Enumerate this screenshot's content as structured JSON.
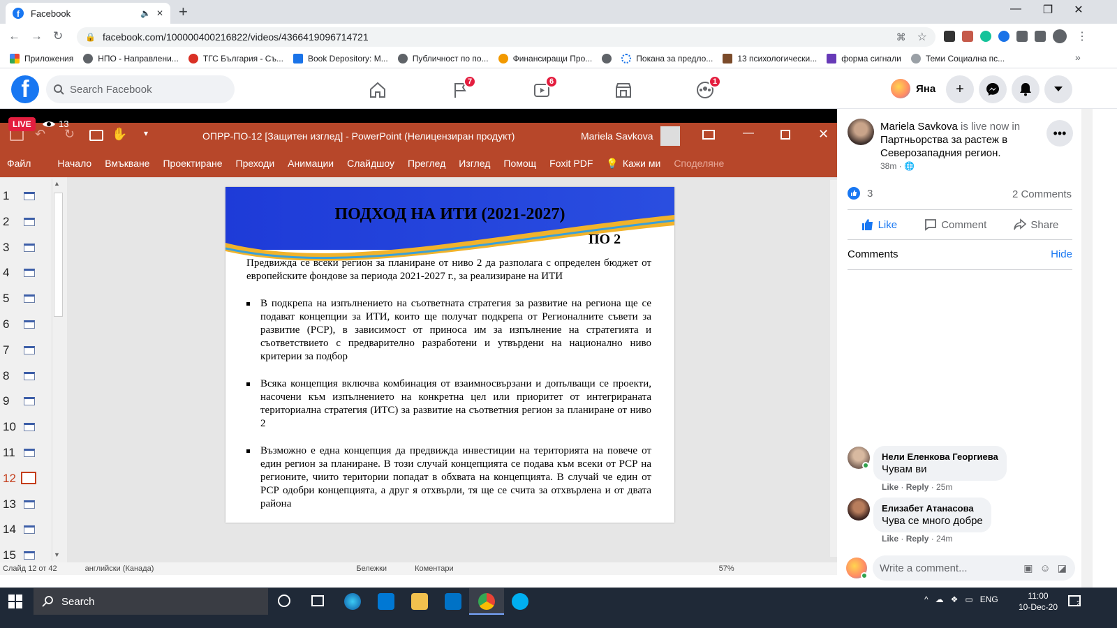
{
  "browser": {
    "tab_title": "Facebook",
    "url": "facebook.com/100000400216822/videos/4366419096714721",
    "bookmarks": [
      {
        "label": "Приложения",
        "color": "#ea4335"
      },
      {
        "label": "НПО - Направлени...",
        "color": "#5f6368"
      },
      {
        "label": "ТГС България - Съ...",
        "color": "#d93025"
      },
      {
        "label": "Book Depository: M...",
        "color": "#1a73e8"
      },
      {
        "label": "Публичност по по...",
        "color": "#5f6368"
      },
      {
        "label": "Финансиращи Про...",
        "color": "#f29900"
      },
      {
        "label": "",
        "color": "#5f6368"
      },
      {
        "label": "Покана за предло...",
        "color": "#1a73e8"
      },
      {
        "label": "13 психологически...",
        "color": "#7b4b2a"
      },
      {
        "label": "форма сигнали",
        "color": "#673ab7"
      },
      {
        "label": "Теми Социална пс...",
        "color": "#9aa0a6"
      }
    ]
  },
  "fb": {
    "search_placeholder": "Search Facebook",
    "badges": {
      "pages": "7",
      "watch": "6",
      "groups": "1"
    },
    "profile_name": "Яна",
    "brand_color": "#1877f2"
  },
  "video": {
    "live_label": "LIVE",
    "viewers": "13",
    "pp_title": "ОПРР-ПО-12 [Защитен изглед]  -  PowerPoint (Нелицензиран продукт)",
    "pp_user": "Mariela Savkova",
    "ribbon": [
      "Файл",
      "Начало",
      "Вмъкване",
      "Проектиране",
      "Преходи",
      "Анимации",
      "Слайдшоу",
      "Преглед",
      "Изглед",
      "Помощ",
      "Foxit PDF",
      "Кажи ми",
      "Споделяне"
    ],
    "thumbs": [
      "1",
      "2",
      "3",
      "4",
      "5",
      "6",
      "7",
      "8",
      "9",
      "10",
      "11",
      "12",
      "13",
      "14",
      "15"
    ],
    "active_thumb": "12",
    "slide": {
      "title": "ПОДХОД НА ИТИ (2021-2027)",
      "subtitle": "ПО 2",
      "intro": "Предвижда се всеки регион за планиране от ниво 2 да разполага с определен бюджет от европейските фондове за периода 2021-2027 г., за реализиране на ИТИ",
      "bullets": [
        "В подкрепа на изпълнението на съответната стратегия за развитие на региона ще се подават концепции за ИТИ, които ще получат подкрепа от Регионалните съвети за развитие (РСР), в зависимост от приноса им за изпълнение на стратегията и съответствието с предварително разработени и утвърдени на национално ниво критерии за подбор",
        "Всяка концепция включва комбинация от взаимносвързани и допълващи се проекти, насочени към изпълнението на конкретна цел или приоритет от интегрираната териториална стратегия (ИТС) за развитие на съответния регион за планиране от ниво 2",
        "Възможно е една концепция да предвижда инвестиции на територията на повече от един регион за планиране. В този случай концепцията се подава към всеки от РСР на регионите, чиито територии попадат в обхвата на концепцията. В случай че един от РСР одобри концепцията, а друг я отхвърли, тя ще се счита за отхвърлена и от двата района"
      ]
    },
    "status": {
      "slide_no": "Слайд 12 от 42",
      "lang": "английски (Канада)",
      "notes": "Бележки",
      "comments": "Коментари",
      "zoom": "57%"
    }
  },
  "post": {
    "author": "Mariela Savkova",
    "live_text": " is live now in ",
    "group": "Партньорства за растеж в Северозападния регион",
    "group_end": ".",
    "time": "38m",
    "like_count": "3",
    "comment_count": "2 Comments",
    "like_label": "Like",
    "comment_label": "Comment",
    "share_label": "Share",
    "comments_header": "Comments",
    "hide_label": "Hide",
    "comments": [
      {
        "name": "Нели Еленкова Георгиева",
        "text": "Чувам ви",
        "like": "Like",
        "reply": "Reply",
        "time": "25m"
      },
      {
        "name": "Елизабет Атанасова",
        "text": "Чува се много добре",
        "like": "Like",
        "reply": "Reply",
        "time": "24m"
      }
    ],
    "write_placeholder": "Write a comment..."
  },
  "taskbar": {
    "search_label": "Search",
    "lang": "ENG",
    "time": "11:00",
    "date": "10-Dec-20",
    "notif_count": "2"
  }
}
